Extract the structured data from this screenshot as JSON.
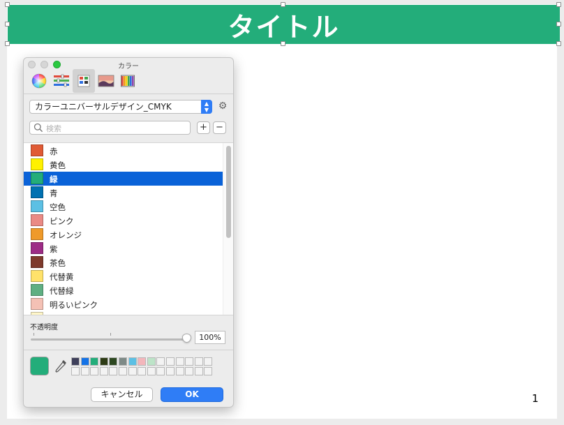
{
  "slide": {
    "title": "タイトル",
    "page_number": "1",
    "title_bg": "#23ad7a"
  },
  "panel": {
    "window_title": "カラー",
    "modes": [
      {
        "name": "color-wheel-icon"
      },
      {
        "name": "sliders-icon"
      },
      {
        "name": "palettes-icon",
        "active": true
      },
      {
        "name": "image-palettes-icon"
      },
      {
        "name": "pencils-icon"
      }
    ],
    "palette_select": "カラーユニバーサルデザイン_CMYK",
    "search_placeholder": "検索",
    "add_label": "+",
    "remove_label": "−",
    "colors": [
      {
        "label": "赤",
        "hex": "#e05a34"
      },
      {
        "label": "黄色",
        "hex": "#fff100"
      },
      {
        "label": "緑",
        "hex": "#23ad7a",
        "selected": true
      },
      {
        "label": "青",
        "hex": "#0071b1"
      },
      {
        "label": "空色",
        "hex": "#5cc0e4"
      },
      {
        "label": "ピンク",
        "hex": "#ea8a85"
      },
      {
        "label": "オレンジ",
        "hex": "#ef9a2a"
      },
      {
        "label": "紫",
        "hex": "#9d2c86"
      },
      {
        "label": "茶色",
        "hex": "#7e3a2c"
      },
      {
        "label": "代替黄",
        "hex": "#ffe26a"
      },
      {
        "label": "代替緑",
        "hex": "#5faf82"
      },
      {
        "label": "明るいピンク",
        "hex": "#f4c1b5"
      },
      {
        "label": "",
        "hex": "#fff6c8"
      }
    ],
    "opacity_label": "不透明度",
    "opacity_value": "100%",
    "opacity_fraction": 1.0,
    "current_color": "#23ad7a",
    "recent_swatches": [
      "#3e3f5a",
      "#1573e6",
      "#23ad7a",
      "#2d3b15",
      "#2c4720",
      "#7e8a87",
      "#5cc0e4",
      "#f3b6bb",
      "#bde4c8"
    ],
    "cancel_label": "キャンセル",
    "ok_label": "OK"
  }
}
